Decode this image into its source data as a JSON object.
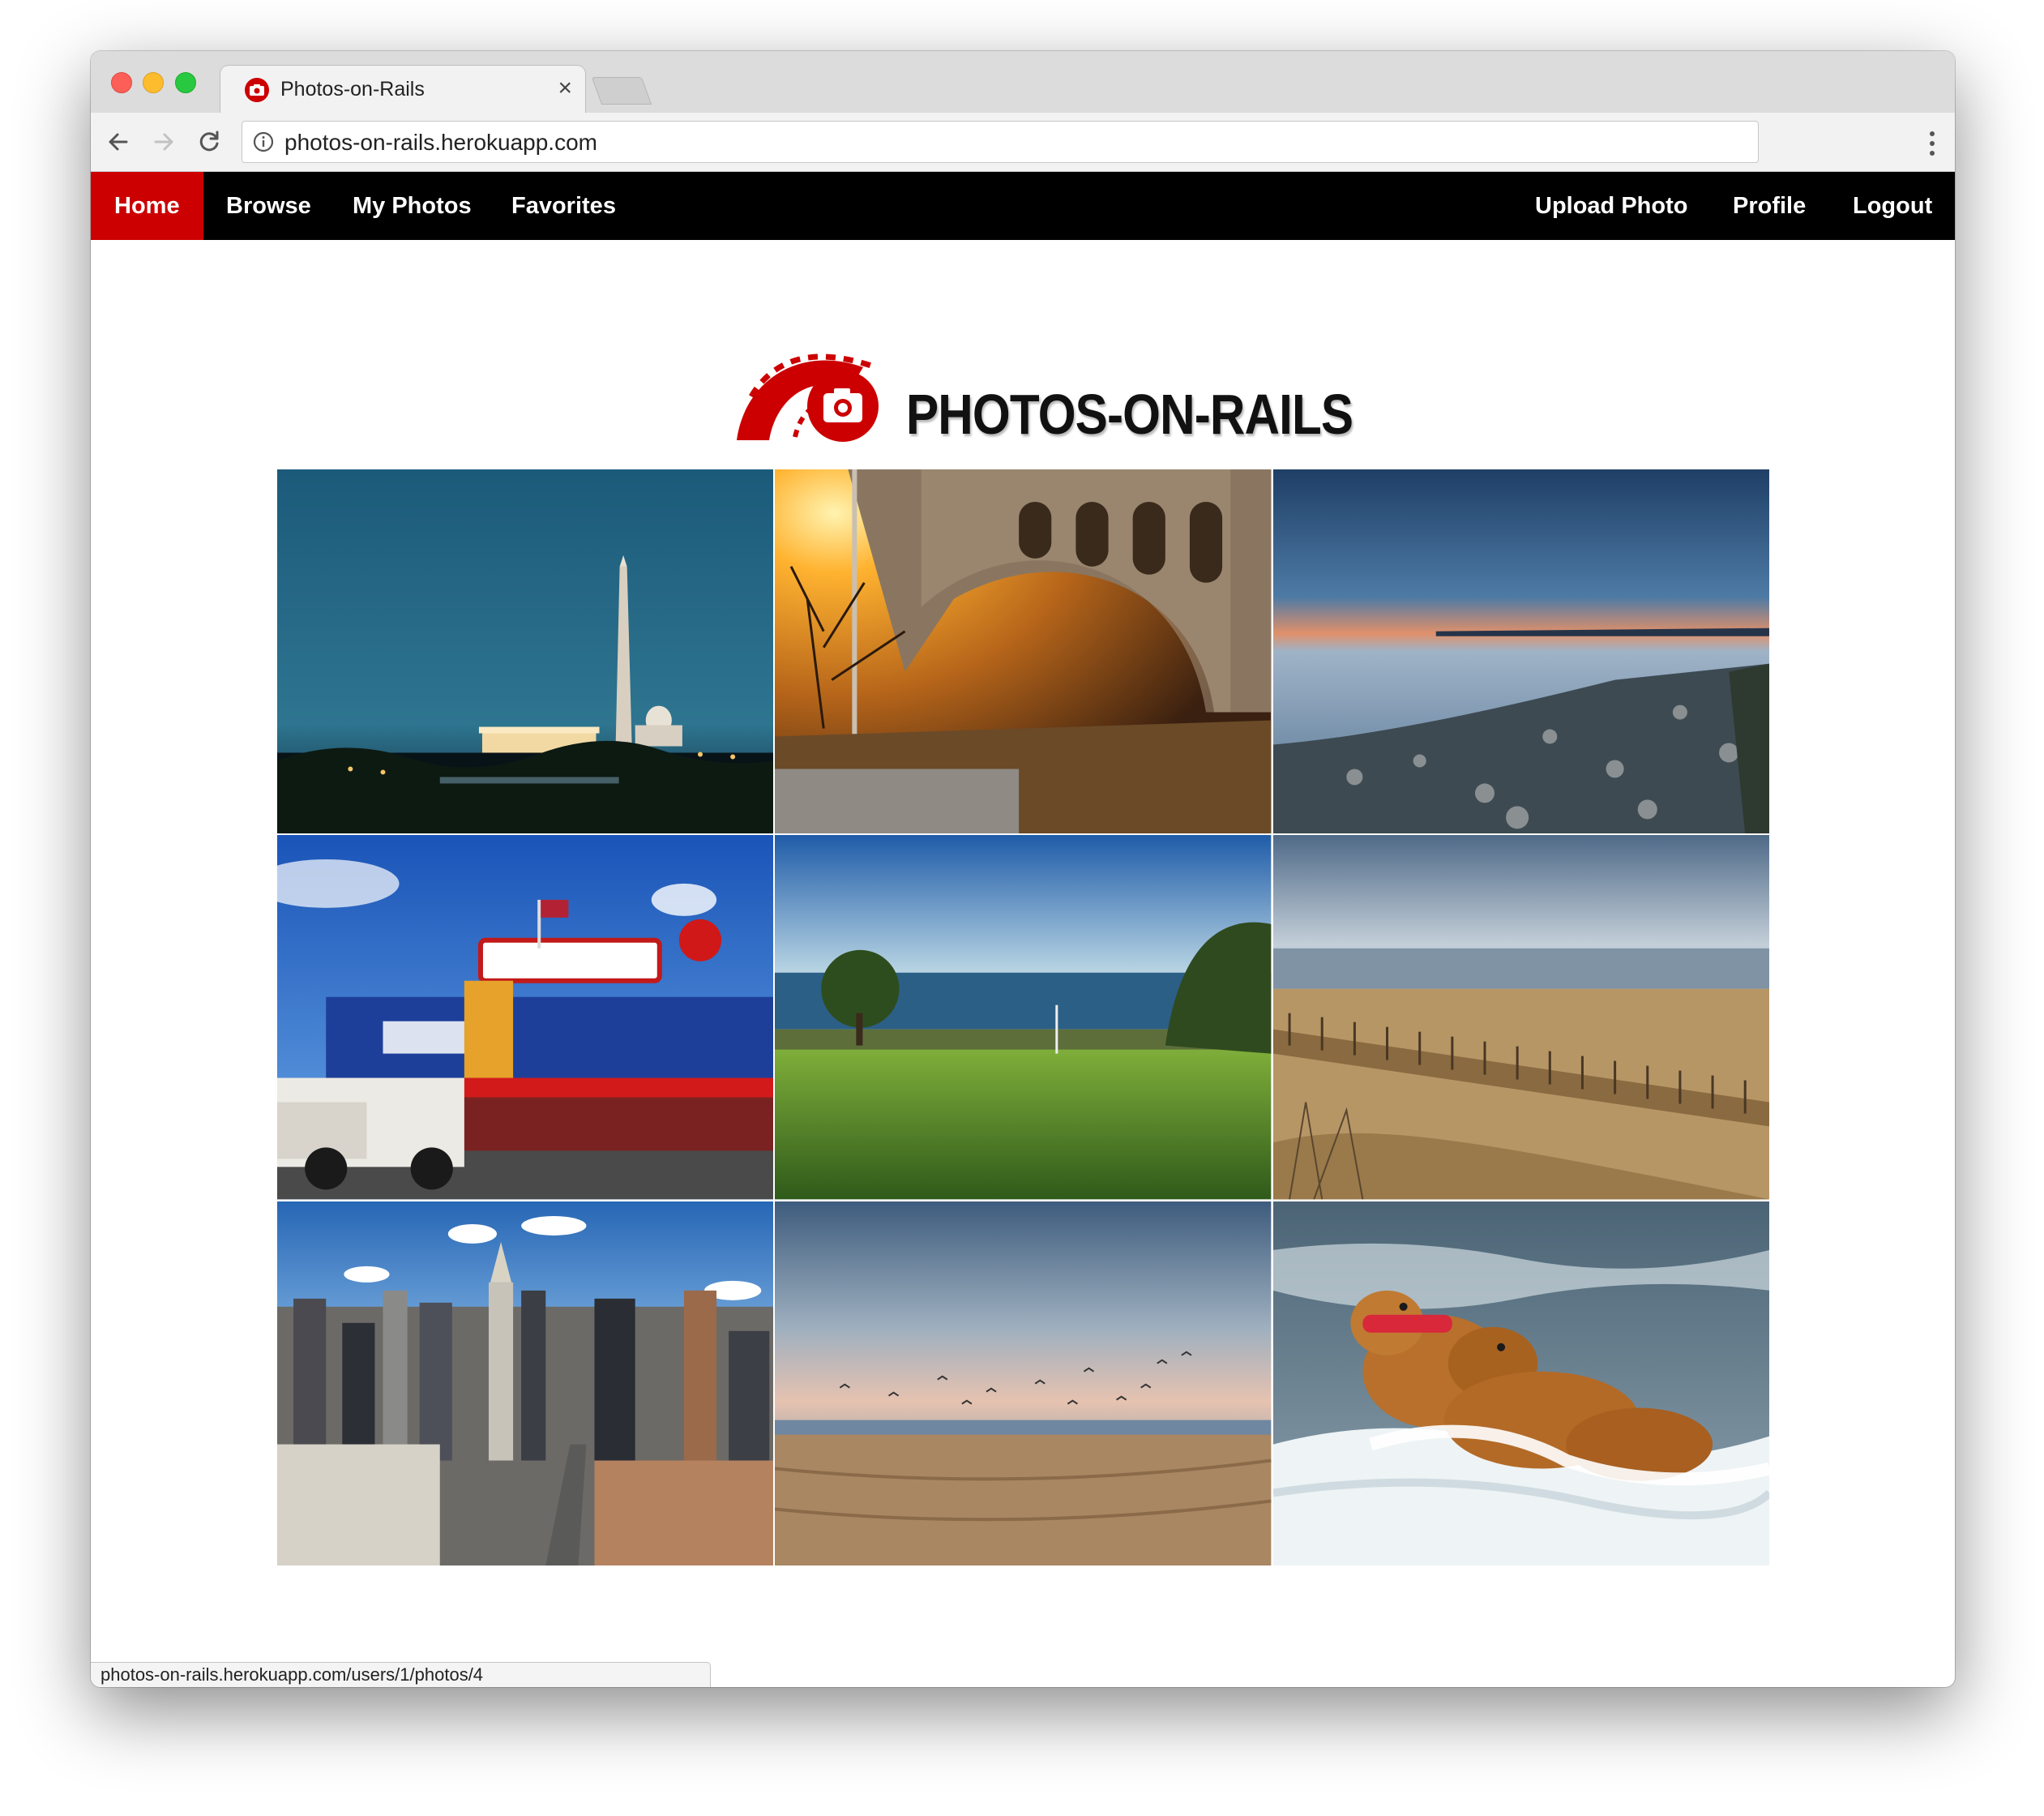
{
  "browser": {
    "tab_title": "Photos-on-Rails",
    "tab_close": "×",
    "url": "photos-on-rails.herokuapp.com",
    "status_url": "photos-on-rails.herokuapp.com/users/1/photos/4"
  },
  "nav": {
    "left": [
      "Home",
      "Browse",
      "My Photos",
      "Favorites"
    ],
    "right": [
      "Upload Photo",
      "Profile",
      "Logout"
    ],
    "active": "Home",
    "active_color": "#cc0000",
    "bar_color": "#000000"
  },
  "brand": {
    "name": "PHOTOS-ON-RAILS",
    "accent": "#cc0000"
  },
  "photos": [
    {
      "name": "washington-monument-night"
    },
    {
      "name": "bridge-arch-sunset"
    },
    {
      "name": "rocky-shore-dusk"
    },
    {
      "name": "seafood-market-storefront"
    },
    {
      "name": "golf-course-ocean"
    },
    {
      "name": "beach-dune-fence"
    },
    {
      "name": "manhattan-skyline"
    },
    {
      "name": "beach-seagulls-sunset"
    },
    {
      "name": "golden-retrievers-surf"
    }
  ],
  "icons": {
    "back": "arrow-left-icon",
    "forward": "arrow-right-icon",
    "reload": "reload-icon",
    "info": "info-icon",
    "menu": "three-dots-icon",
    "favicon": "camera-icon"
  }
}
